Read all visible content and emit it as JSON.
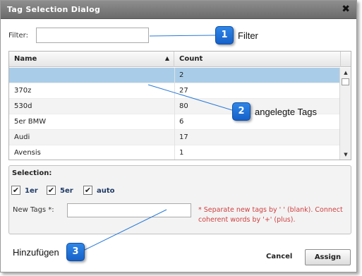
{
  "dialog": {
    "title": "Tag Selection Dialog",
    "close_glyph": "✖"
  },
  "filter": {
    "label": "Filter:",
    "value": ""
  },
  "grid": {
    "headers": {
      "name": "Name",
      "count": "Count",
      "sort_glyph": "▲"
    },
    "rows": [
      {
        "name": "",
        "count": "2"
      },
      {
        "name": "370z",
        "count": "27"
      },
      {
        "name": "530d",
        "count": "80"
      },
      {
        "name": "5er BMW",
        "count": "6"
      },
      {
        "name": "Audi",
        "count": "17"
      },
      {
        "name": "Avensis",
        "count": "1"
      }
    ],
    "selected_row_index": 0,
    "scroll": {
      "up_glyph": "▲",
      "down_glyph": "▼"
    }
  },
  "selection": {
    "title": "Selection:",
    "tags": [
      {
        "label": "1er",
        "checked": true
      },
      {
        "label": "5er",
        "checked": true
      },
      {
        "label": "auto",
        "checked": true
      }
    ],
    "check_glyph": "✔",
    "new_tags_label": "New Tags *:",
    "new_tags_value": "",
    "hint": "* Separate new tags by ' ' (blank). Connect coherent words by '+' (plus)."
  },
  "buttons": {
    "cancel": "Cancel",
    "assign": "Assign"
  },
  "annotations": [
    {
      "number": "1",
      "text": "Filter"
    },
    {
      "number": "2",
      "text": "angelegte Tags"
    },
    {
      "number": "3",
      "text": "Hinzufügen"
    }
  ],
  "colors": {
    "annotation": "#1f73da",
    "selected_row": "#a9cde9",
    "hint": "#d04040",
    "title_bar": "#7c7c7c"
  }
}
